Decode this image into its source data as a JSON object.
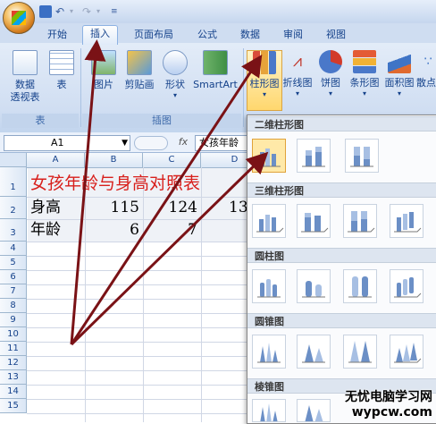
{
  "tabs": [
    "开始",
    "插入",
    "页面布局",
    "公式",
    "数据",
    "审阅",
    "视图"
  ],
  "ribbon": {
    "pivot": {
      "line1": "数据",
      "line2": "透视表"
    },
    "table": "表",
    "picture": "图片",
    "clipart": "剪贴画",
    "shapes": "形状",
    "smartart": "SmartArt",
    "bar": "柱形图",
    "line": "折线图",
    "pie": "饼图",
    "hbar": "条形图",
    "area": "面积图",
    "scatter": "散点",
    "group_table": "表",
    "group_illus": "插图"
  },
  "formula_bar": {
    "cell_ref": "A1",
    "fx": "fx",
    "content": "女孩年龄"
  },
  "columns": [
    "A",
    "B",
    "C",
    "D"
  ],
  "rows": [
    "1",
    "2",
    "3",
    "4",
    "5",
    "6",
    "7",
    "8",
    "9",
    "10",
    "11",
    "12",
    "13",
    "14",
    "15"
  ],
  "sheet": {
    "title": "女孩年龄与身高对照表",
    "row2": {
      "label": "身高",
      "b": "115",
      "c": "124",
      "d": "13"
    },
    "row3": {
      "label": "年龄",
      "b": "6",
      "c": "7"
    }
  },
  "gallery": {
    "sections": [
      "二维柱形图",
      "三维柱形图",
      "圆柱图",
      "圆锥图",
      "棱锥图"
    ]
  },
  "watermark": {
    "line1": "无忧电脑学习网",
    "line2": "wypcw.com"
  },
  "colors": {
    "arrow": "#7a1216",
    "title_text": "#d8201c",
    "selected": "#ffe9a8"
  }
}
